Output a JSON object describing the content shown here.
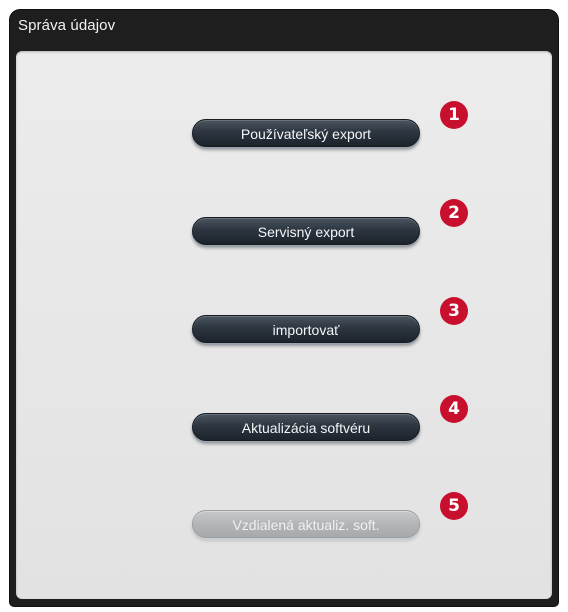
{
  "window": {
    "title": "Správa údajov"
  },
  "buttons": [
    {
      "label": "Používateľský export",
      "enabled": true
    },
    {
      "label": "Servisný export",
      "enabled": true
    },
    {
      "label": "importovať",
      "enabled": true
    },
    {
      "label": "Aktualizácia softvéru",
      "enabled": true
    },
    {
      "label": "Vzdialená aktualiz. soft.",
      "enabled": false
    }
  ],
  "callouts": [
    "1",
    "2",
    "3",
    "4",
    "5"
  ],
  "colors": {
    "titlebar": "#1e1e1e",
    "panel": "#e8e8e8",
    "button": "#2d3640",
    "button_disabled": "#b3b6b9",
    "callout": "#c8102e"
  }
}
